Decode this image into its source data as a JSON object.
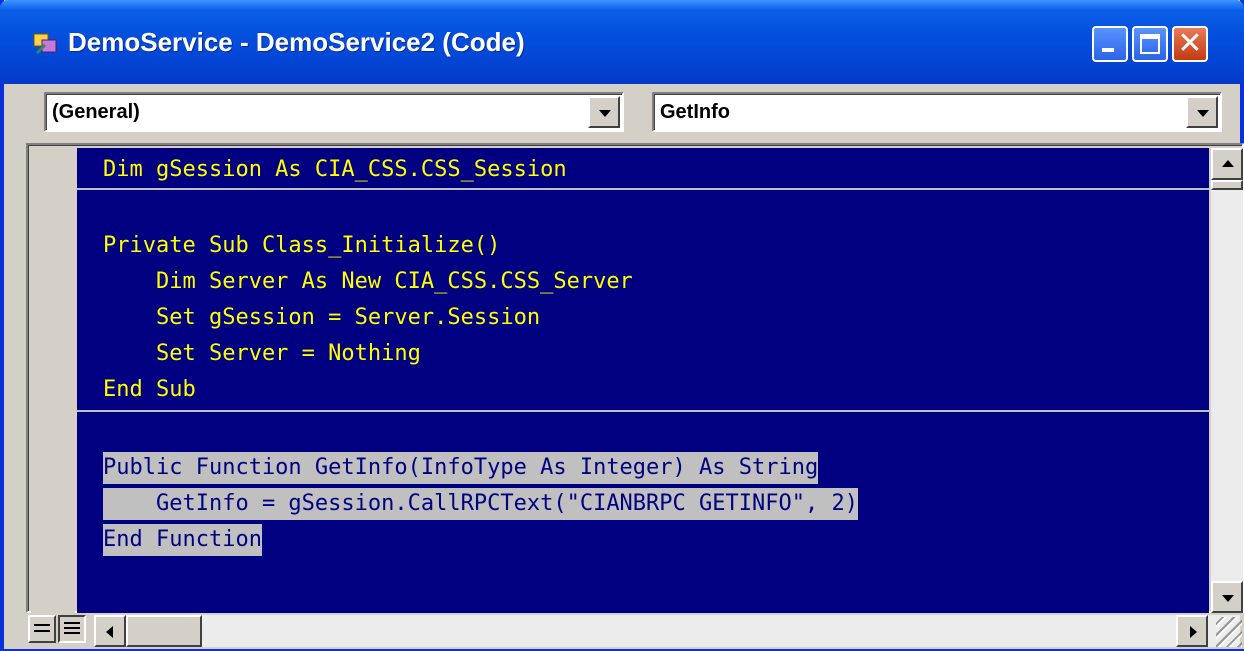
{
  "window": {
    "title": "DemoService - DemoService2 (Code)",
    "icon": "vb-project-icon",
    "controls": [
      "minimize-icon",
      "maximize-icon",
      "close-icon"
    ]
  },
  "object_combo": {
    "value": "(General)"
  },
  "procedure_combo": {
    "value": "GetInfo"
  },
  "code": {
    "lines": [
      "Dim gSession As CIA_CSS.CSS_Session",
      "Private Sub Class_Initialize()",
      "    Dim Server As New CIA_CSS.CSS_Server",
      "    Set gSession = Server.Session",
      "    Set Server = Nothing",
      "End Sub",
      "Public Function GetInfo(InfoType As Integer) As String",
      "    GetInfo = gSession.CallRPCText(\"CIANBRPC GETINFO\", 2)",
      "End Function"
    ],
    "selected_lines": [
      6,
      7,
      8
    ]
  },
  "colors": {
    "code_background": "#000080",
    "code_text": "#ffff00",
    "selection_background": "#c0c0c0",
    "title_bar": "#0450de"
  }
}
